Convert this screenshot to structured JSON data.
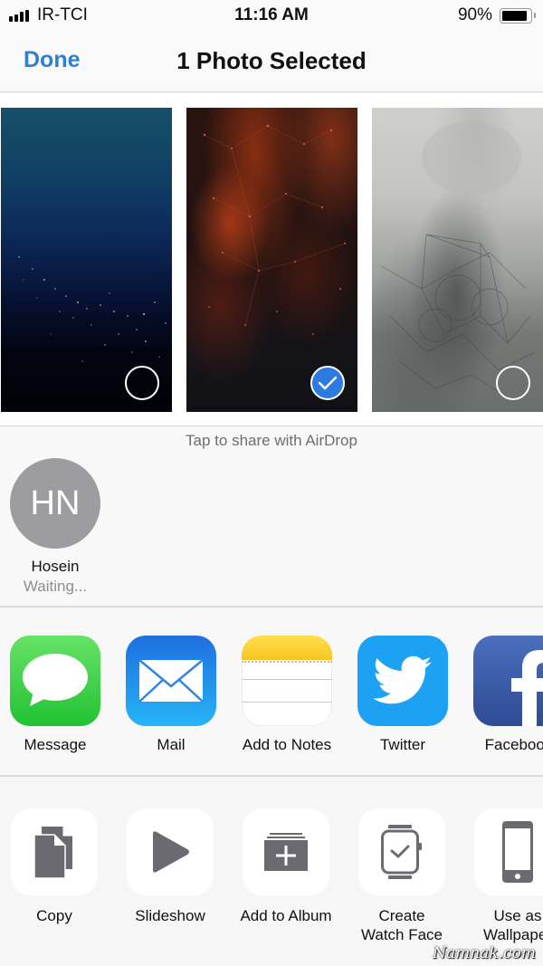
{
  "status_bar": {
    "carrier": "IR-TCI",
    "time": "11:16 AM",
    "battery_percent_label": "90%",
    "battery_level": 0.9,
    "signal_bars": 4
  },
  "nav": {
    "done_label": "Done",
    "title": "1 Photo Selected"
  },
  "photos": [
    {
      "name": "blue-particles-wallpaper",
      "selected": false
    },
    {
      "name": "orange-network-wallpaper",
      "selected": true
    },
    {
      "name": "gray-sketch-wallpaper",
      "selected": false
    }
  ],
  "airdrop": {
    "hint": "Tap to share with AirDrop",
    "contacts": [
      {
        "initials": "HN",
        "name": "Hosein",
        "status": "Waiting..."
      }
    ]
  },
  "apps": [
    {
      "label": "Message",
      "icon": "messages-icon"
    },
    {
      "label": "Mail",
      "icon": "mail-icon"
    },
    {
      "label": "Add to Notes",
      "icon": "notes-icon"
    },
    {
      "label": "Twitter",
      "icon": "twitter-icon"
    },
    {
      "label": "Facebook",
      "icon": "facebook-icon"
    }
  ],
  "actions": [
    {
      "label": "Copy",
      "icon": "copy-icon"
    },
    {
      "label": "Slideshow",
      "icon": "play-icon"
    },
    {
      "label": "Add to Album",
      "icon": "add-album-icon"
    },
    {
      "label": "Create\nWatch Face",
      "line1": "Create",
      "line2": "Watch Face",
      "icon": "watch-icon"
    },
    {
      "label": "Use as\nWallpaper",
      "line1": "Use as",
      "line2": "Wallpaper",
      "icon": "iphone-icon"
    }
  ],
  "colors": {
    "accent": "#2f7fd0",
    "selected_check": "#2d7ae0",
    "action_glyph": "#6b6a71"
  },
  "watermark": "Namnak.com"
}
